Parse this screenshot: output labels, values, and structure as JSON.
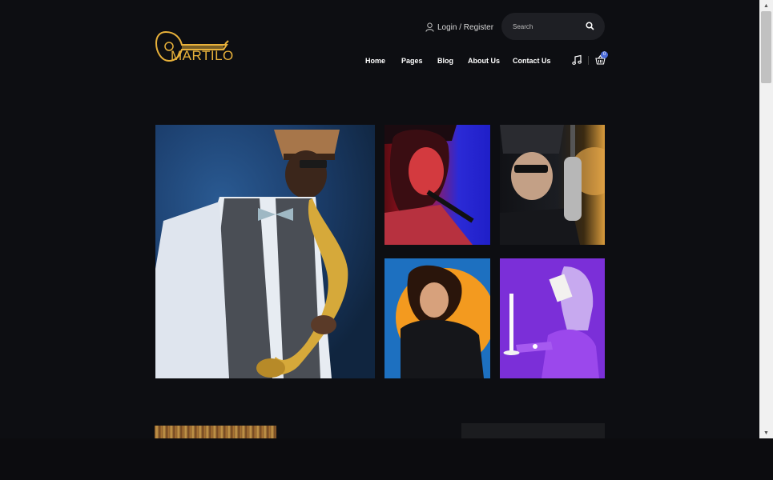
{
  "brand": {
    "name": "MARTILO",
    "color": "#e8b13a"
  },
  "header": {
    "login_label": "Login / Register",
    "search_placeholder": "Search",
    "nav": {
      "home": "Home",
      "pages": "Pages",
      "blog": "Blog",
      "about": "About Us",
      "contact": "Contact Us"
    },
    "cart_count": "0"
  },
  "gallery": {
    "tiles": [
      "saxophone-player",
      "singer-red-blue",
      "singer-studio-mic",
      "woman-orange-circle",
      "purple-figure-candle"
    ]
  },
  "colors": {
    "background": "#0d0e12",
    "search_bg": "#1e1f24",
    "badge": "#4b6bd8"
  }
}
